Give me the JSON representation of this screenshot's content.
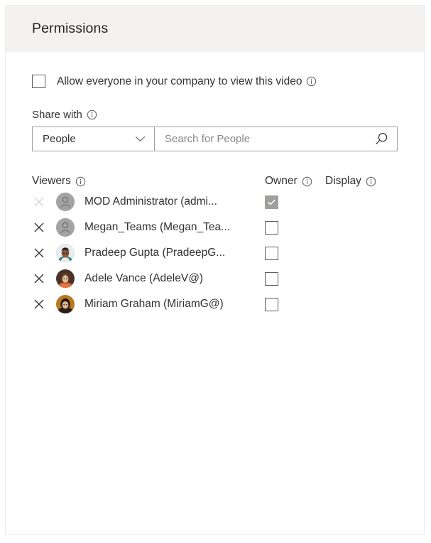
{
  "panel": {
    "title": "Permissions"
  },
  "allow_everyone": {
    "label": "Allow everyone in your company to view this video",
    "checked": false,
    "info_icon": "info-icon"
  },
  "share_with": {
    "label": "Share with",
    "info_icon": "info-icon",
    "dropdown": {
      "value": "People",
      "chevron_icon": "chevron-down-icon",
      "options": [
        "People"
      ]
    },
    "search": {
      "value": "",
      "placeholder": "Search for People",
      "icon": "search-icon"
    }
  },
  "table": {
    "columns": [
      {
        "label": "Viewers",
        "info_icon": "info-icon"
      },
      {
        "label": "Owner",
        "info_icon": "info-icon"
      },
      {
        "label": "Display",
        "info_icon": "info-icon"
      }
    ],
    "rows": [
      {
        "name": "MOD Administrator (admi...",
        "avatar": "person-placeholder-avatar",
        "owner_checked": true,
        "owner_disabled": true,
        "remove_icon": "close-icon",
        "remove_disabled": true
      },
      {
        "name": "Megan_Teams (Megan_Tea...",
        "avatar": "person-placeholder-avatar",
        "owner_checked": false,
        "owner_disabled": false,
        "remove_icon": "close-icon",
        "remove_disabled": false
      },
      {
        "name": "Pradeep Gupta (PradeepG...",
        "avatar": "photo-avatar",
        "owner_checked": false,
        "owner_disabled": false,
        "remove_icon": "close-icon",
        "remove_disabled": false
      },
      {
        "name": "Adele Vance (AdeleV@)",
        "avatar": "photo-avatar",
        "owner_checked": false,
        "owner_disabled": false,
        "remove_icon": "close-icon",
        "remove_disabled": false
      },
      {
        "name": "Miriam Graham (MiriamG@)",
        "avatar": "photo-avatar",
        "owner_checked": false,
        "owner_disabled": false,
        "remove_icon": "close-icon",
        "remove_disabled": false
      }
    ]
  },
  "colors": {
    "header_bg": "#f3f2f1",
    "panel_border": "#eceaea",
    "text": "#323130",
    "placeholder": "#8a8886",
    "field_border": "#a19f9d",
    "checkbox_border": "#605e5c",
    "checked_fill": "#a19f9d",
    "avatar_bg": "#a3a3a3",
    "x_enabled": "#323130",
    "x_disabled": "#d6d4d2"
  }
}
